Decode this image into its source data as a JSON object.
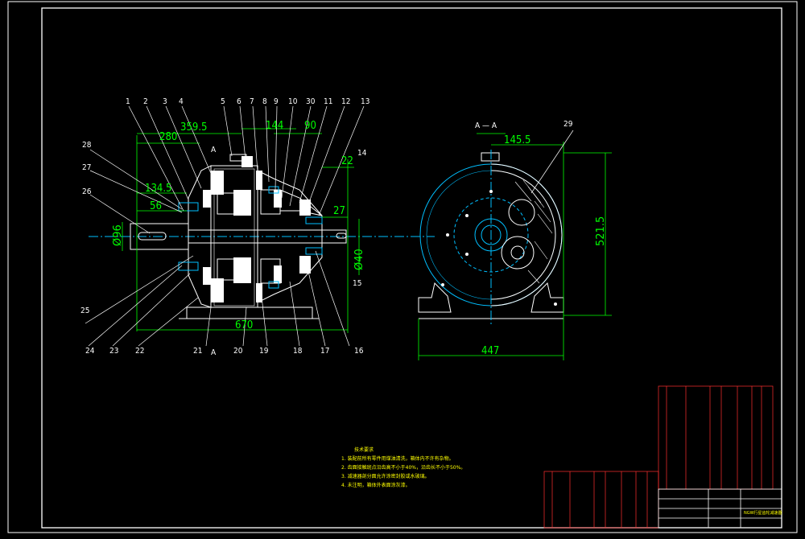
{
  "drawing": {
    "section_label": "A — A",
    "section_mark": "A",
    "part_labels_top": [
      "1",
      "2",
      "3",
      "4",
      "5",
      "6",
      "7",
      "8",
      "9",
      "10",
      "30",
      "11",
      "12",
      "13"
    ],
    "part_labels_left": [
      "28",
      "27",
      "26",
      "25",
      "24",
      "23",
      "22"
    ],
    "part_labels_bottom": [
      "21",
      "20",
      "19",
      "18",
      "17",
      "16"
    ],
    "part_label_right": [
      "14",
      "15",
      "29"
    ],
    "dimensions": {
      "d280": "280",
      "d359": "359.5",
      "d144": "144",
      "d90": "90",
      "d1345": "134.5",
      "d56": "56",
      "d22": "22",
      "d27": "27",
      "d670": "670",
      "dphi96": "Ø96",
      "dphi40": "Ø40",
      "d1455": "145.5",
      "d5215": "521.5",
      "d447": "447"
    }
  },
  "tech_req": {
    "title": "技术要求",
    "lines": [
      "1. 装配前所有零件用煤油清洗，箱体内不许有杂物。",
      "2. 齿面接触斑点沿齿高不小于40%，沿齿长不小于50%。",
      "3. 减速器剖分面允许涂密封胶或水玻璃。",
      "4. 未注明，箱体外表面涂灰漆。"
    ]
  },
  "title_block": {
    "name": "NGW行星齿轮减速器"
  }
}
